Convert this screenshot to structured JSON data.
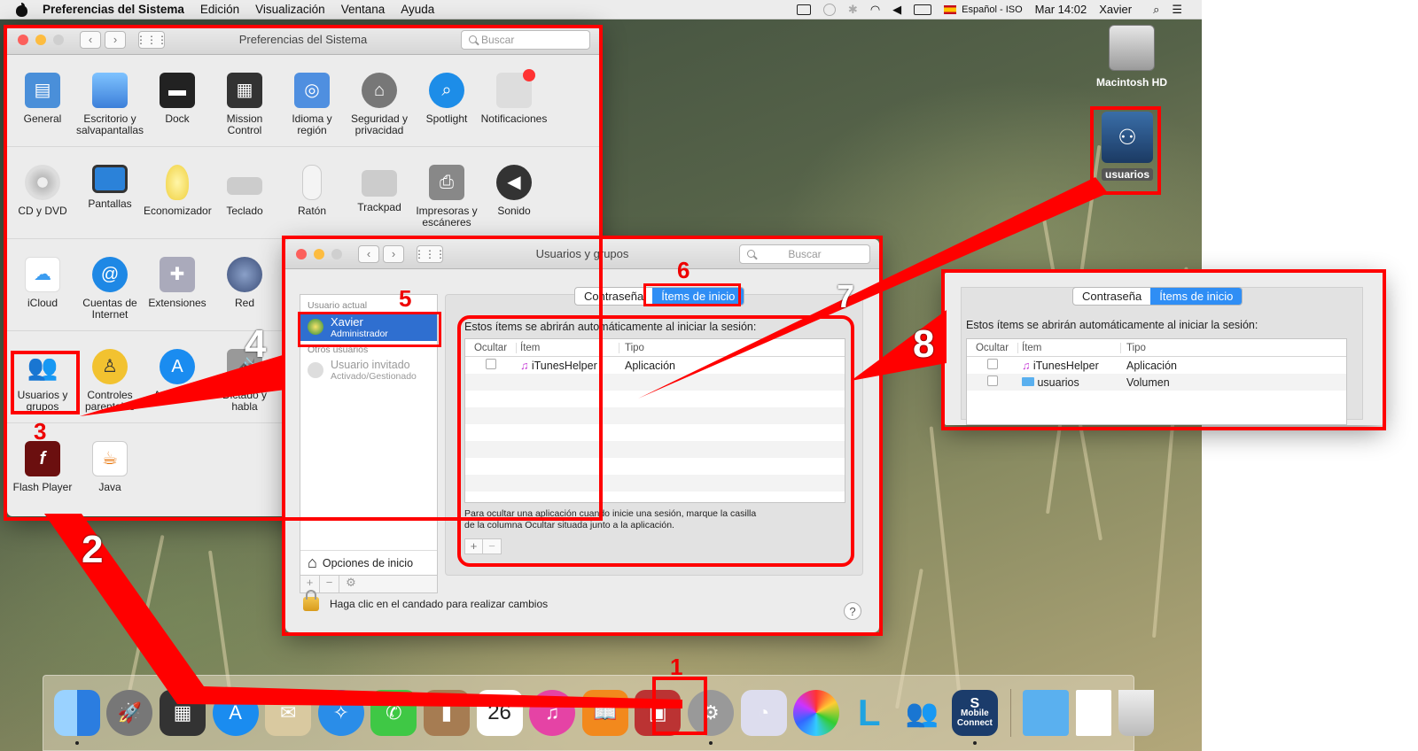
{
  "menubar": {
    "app": "Preferencias del Sistema",
    "items": [
      "Edición",
      "Visualización",
      "Ventana",
      "Ayuda"
    ],
    "input_source": "Español - ISO",
    "clock": "Mar 14:02",
    "user": "Xavier"
  },
  "desktop": {
    "hd_label": "Macintosh HD",
    "volume_label": "usuarios"
  },
  "prefs": {
    "title": "Preferencias del Sistema",
    "search_placeholder": "Buscar",
    "row1": [
      "General",
      "Escritorio y salvapantallas",
      "Dock",
      "Mission Control",
      "Idioma y región",
      "Seguridad y privacidad",
      "Spotlight",
      "Notificaciones"
    ],
    "row2": [
      "CD y DVD",
      "Pantallas",
      "Economizador",
      "Teclado",
      "Ratón",
      "Trackpad",
      "Impresoras y escáneres",
      "Sonido"
    ],
    "row3": [
      "iCloud",
      "Cuentas de Internet",
      "Extensiones",
      "Red"
    ],
    "row4": [
      "Usuarios y grupos",
      "Controles parentales",
      "App Store",
      "Dictado y habla"
    ],
    "row5": [
      "Flash Player",
      "Java"
    ]
  },
  "users": {
    "title": "Usuarios y grupos",
    "search_placeholder": "Buscar",
    "current_user_header": "Usuario actual",
    "current_user_name": "Xavier",
    "current_user_role": "Administrador",
    "other_users_header": "Otros usuarios",
    "guest_name": "Usuario invitado",
    "guest_status": "Activado/Gestionado",
    "login_options": "Opciones de inicio",
    "tab_password": "Contraseña",
    "tab_login_items": "Ítems de inicio",
    "intro": "Estos ítems se abrirán automáticamente al iniciar la sesión:",
    "col_hide": "Ocultar",
    "col_item": "Ítem",
    "col_type": "Tipo",
    "items": [
      {
        "name": "iTunesHelper",
        "type": "Aplicación"
      }
    ],
    "footnote_1": "Para ocultar una aplicación cuando inicie una sesión, marque la casilla",
    "footnote_2": "de la columna Ocultar situada junto a la aplicación.",
    "lock_text": "Haga clic en el candado para realizar cambios",
    "help": "?"
  },
  "zoom": {
    "tab_password": "Contraseña",
    "tab_login_items": "Ítems de inicio",
    "intro": "Estos ítems se abrirán automáticamente al iniciar la sesión:",
    "col_hide": "Ocultar",
    "col_item": "Ítem",
    "col_type": "Tipo",
    "items": [
      {
        "name": "iTunesHelper",
        "type": "Aplicación"
      },
      {
        "name": "usuarios",
        "type": "Volumen"
      }
    ]
  },
  "dock": {
    "calendar_day": "26",
    "mobile_connect": "Mobile Connect"
  },
  "annotations": [
    "1",
    "2",
    "3",
    "4",
    "5",
    "6",
    "7",
    "8"
  ],
  "colors": {
    "highlight": "#ff0000",
    "selection": "#2f8ef5"
  }
}
